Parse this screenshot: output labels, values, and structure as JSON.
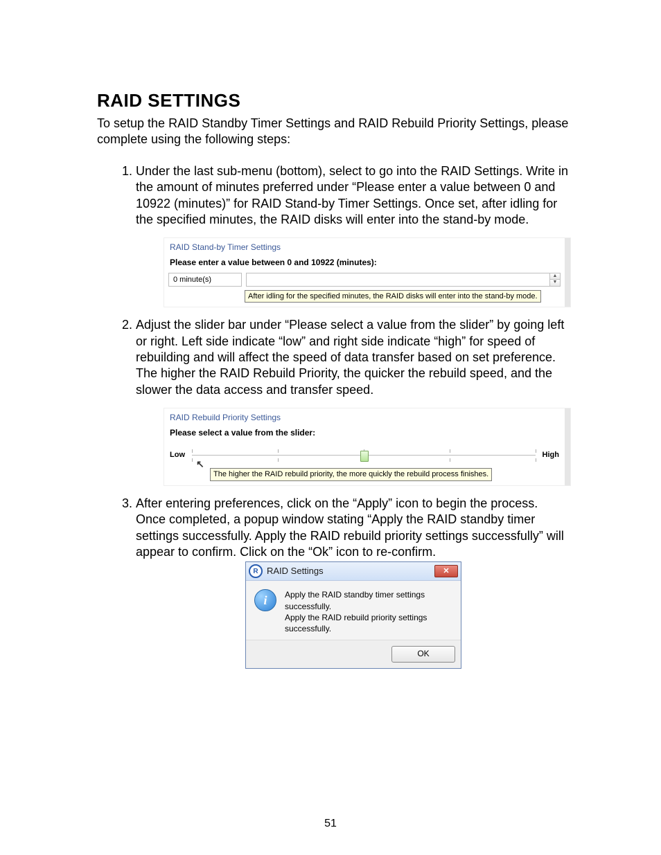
{
  "heading": "RAID SETTINGS",
  "intro": "To setup the RAID Standby Timer Settings and RAID Rebuild Priority Settings, please complete using the following steps:",
  "steps": {
    "s1": "Under the last sub-menu (bottom), select to go into the RAID Settings.  Write in the amount of minutes preferred under “Please enter a value between 0 and 10922 (minutes)” for RAID Stand-by Timer Settings.  Once set, after idling for the specified minutes, the RAID disks will enter into the stand-by mode.",
    "s2": "Adjust the slider bar under “Please select a value from the slider” by going left or right.  Left side indicate “low” and right side indicate “high” for speed of rebuilding and will affect the speed of data transfer based on set preference.  The higher the RAID Rebuild Priority, the quicker the rebuild speed, and the slower the data access and transfer speed.",
    "s3": "After entering preferences, click on the “Apply” icon to begin the process.  Once completed, a popup window stating “Apply the RAID standby timer settings successfully. Apply the RAID rebuild priority settings successfully” will appear to confirm.  Click on the “Ok” icon to re-confirm."
  },
  "standby_panel": {
    "title": "RAID Stand-by Timer Settings",
    "label": "Please enter a value between 0 and 10922 (minutes):",
    "value_text": "0 minute(s)",
    "spinner_value": "",
    "tooltip": "After idling for the specified minutes, the RAID disks will enter into the stand-by mode."
  },
  "rebuild_panel": {
    "title": "RAID Rebuild Priority Settings",
    "label": "Please select a value from the slider:",
    "low": "Low",
    "high": "High",
    "tooltip": "The higher the RAID rebuild priority, the more quickly the rebuild process finishes."
  },
  "dialog": {
    "title": "RAID Settings",
    "msg1": "Apply the RAID standby timer settings successfully.",
    "msg2": "Apply the RAID rebuild priority settings successfully.",
    "ok": "OK"
  },
  "page_number": "51"
}
